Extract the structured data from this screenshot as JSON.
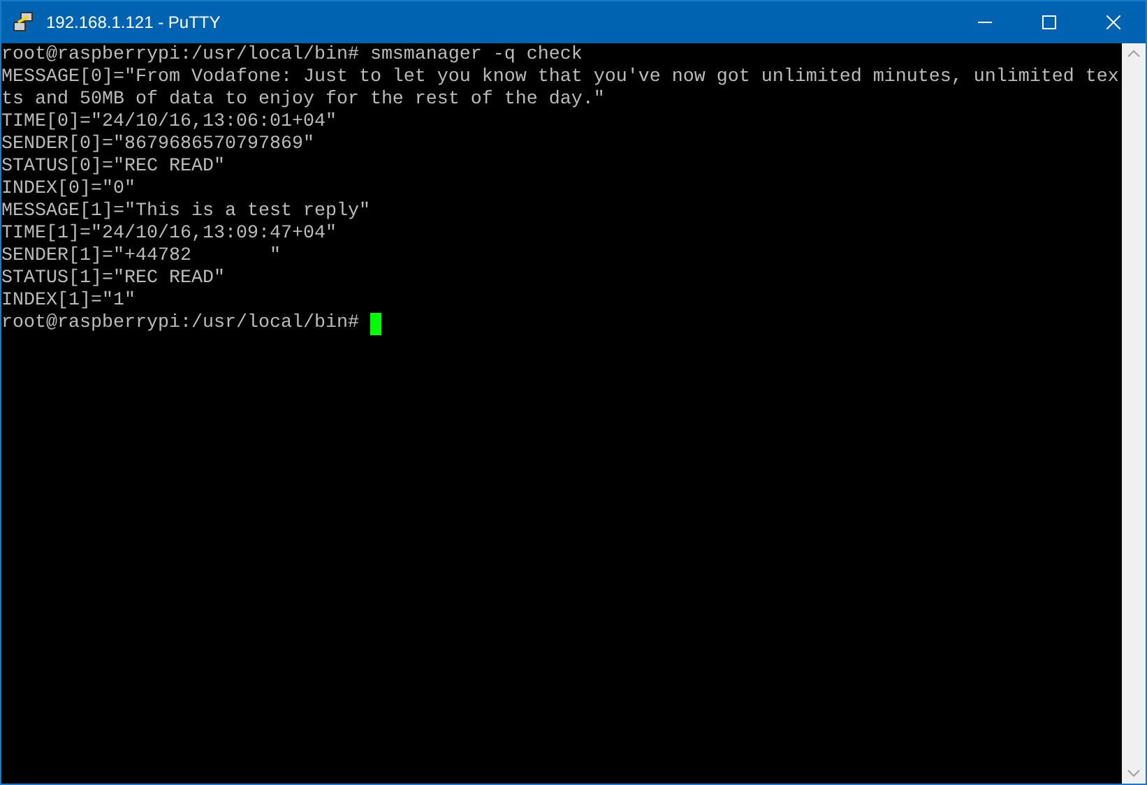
{
  "window": {
    "title": "192.168.1.121 - PuTTY"
  },
  "terminal": {
    "lines": [
      "root@raspberrypi:/usr/local/bin# smsmanager -q check",
      "MESSAGE[0]=\"From Vodafone: Just to let you know that you've now got unlimited minutes, unlimited tex",
      "ts and 50MB of data to enjoy for the rest of the day.\"",
      "TIME[0]=\"24/10/16,13:06:01+04\"",
      "SENDER[0]=\"8679686570797869\"",
      "STATUS[0]=\"REC READ\"",
      "INDEX[0]=\"0\"",
      "MESSAGE[1]=\"This is a test reply\"",
      "TIME[1]=\"24/10/16,13:09:47+04\"",
      "SENDER[1]=\"+44782       \"",
      "STATUS[1]=\"REC READ\"",
      "INDEX[1]=\"1\""
    ],
    "prompt": "root@raspberrypi:/usr/local/bin# "
  }
}
